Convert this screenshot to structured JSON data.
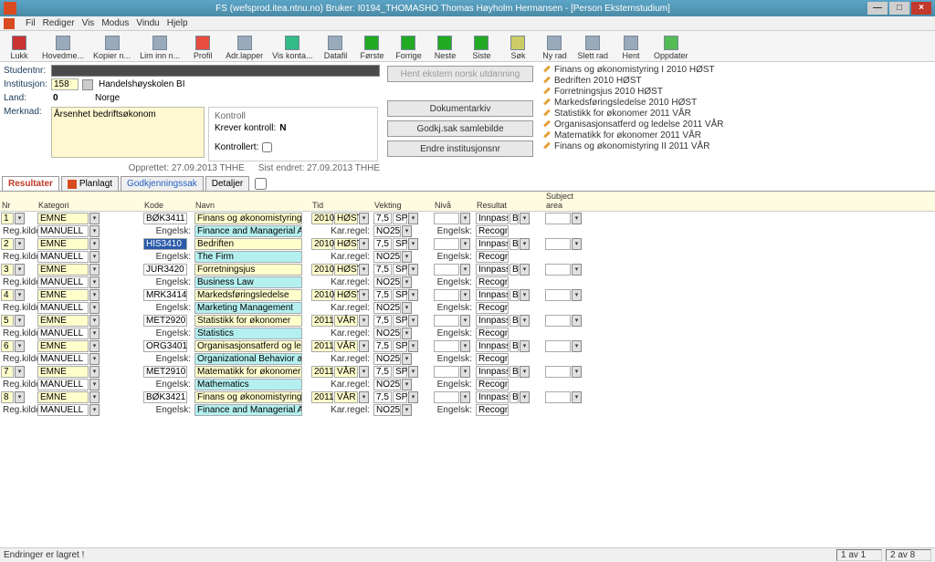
{
  "title": "FS (wefsprod.itea.ntnu.no) Bruker: I0194_THOMASHO Thomas Høyholm Hermansen - [Person Eksternstudium]",
  "menu": {
    "fil": "Fil",
    "rediger": "Rediger",
    "vis": "Vis",
    "modus": "Modus",
    "vindu": "Vindu",
    "hjelp": "Hjelp"
  },
  "toolbar": {
    "lukk": "Lukk",
    "hovedme": "Hovedme...",
    "kopier": "Kopier n...",
    "liminn": "Lim inn n...",
    "profil": "Profil",
    "adr": "Adr.lapper",
    "kontakt": "Vis konta...",
    "datafil": "Datafil",
    "forste": "Første",
    "forrige": "Forrige",
    "neste": "Neste",
    "siste": "Siste",
    "sok": "Søk",
    "nyrad": "Ny rad",
    "slett": "Slett rad",
    "hent": "Hent",
    "oppdater": "Oppdater"
  },
  "info": {
    "studentnr_lbl": "Studentnr:",
    "institusjon_lbl": "Institusjon:",
    "institusjon_val": "158",
    "institusjon_name": "Handelshøyskolen BI",
    "land_lbl": "Land:",
    "land_val": "0",
    "land_name": "Norge",
    "merknad_lbl": "Merknad:",
    "merknad_val": "Årsenhet bedriftsøkonom",
    "kontroll_hdr": "Kontroll",
    "krever": "Krever kontroll:",
    "krever_val": "N",
    "kontrollert": "Kontrollert:",
    "opprettet": "Opprettet: 27.09.2013    THHE",
    "endret": "Sist endret: 27.09.2013    THHE"
  },
  "buttons": {
    "hent_ekstern": "Hent ekstern norsk utdanning",
    "dokarkiv": "Dokumentarkiv",
    "godkj": "Godkj.sak samlebilde",
    "endre": "Endre institusjonsnr"
  },
  "side": [
    "Finans og økonomistyring I 2010 HØST",
    "Bedriften 2010 HØST",
    "Forretningsjus 2010 HØST",
    "Markedsføringsledelse 2010 HØST",
    "Statistikk for økonomer 2011 VÅR",
    "Organisasjonsatferd og ledelse 2011 VÅR",
    "Matematikk for økonomer 2011 VÅR",
    "Finans og økonomistyring II 2011 VÅR"
  ],
  "tabs": {
    "resultater": "Resultater",
    "planlagt": "Planlagt",
    "godkj": "Godkjenningssak",
    "detaljer": "Detaljer"
  },
  "headers": {
    "nr": "Nr",
    "kategori": "Kategori",
    "kode": "Kode",
    "navn": "Navn",
    "tid": "Tid",
    "vekting": "Vekting",
    "niva": "Nivå",
    "resultat": "Resultat",
    "subject": "Subject area"
  },
  "common": {
    "regkilde": "Reg.kilde:",
    "manuell": "MANUELL",
    "engelsk": "Engelsk:",
    "karregel": "Kar.regel:",
    "no25": "NO25",
    "engelsk2": "Engelsk:",
    "recogni": "Recogni",
    "emne": "EMNE",
    "sp": "SP",
    "innpass": "Innpasse",
    "b": "B",
    "host": "HØST",
    "var": "VÅR",
    "v75": "7,5"
  },
  "rows": [
    {
      "nr": "1",
      "kode": "BØK3411",
      "navn": "Finans og økonomistyring I",
      "en": "Finance and Managerial Ac...",
      "aar": "2010",
      "sem": "HØST"
    },
    {
      "nr": "2",
      "kode": "HIS3410",
      "navn": "Bedriften",
      "en": "The Firm",
      "aar": "2010",
      "sem": "HØST",
      "sel": true
    },
    {
      "nr": "3",
      "kode": "JUR3420",
      "navn": "Forretningsjus",
      "en": "Business Law",
      "aar": "2010",
      "sem": "HØST"
    },
    {
      "nr": "4",
      "kode": "MRK3414",
      "navn": "Markedsføringsledelse",
      "en": "Marketing Management",
      "aar": "2010",
      "sem": "HØST"
    },
    {
      "nr": "5",
      "kode": "MET2920",
      "navn": "Statistikk for økonomer",
      "en": "Statistics",
      "aar": "2011",
      "sem": "VÅR"
    },
    {
      "nr": "6",
      "kode": "ORG3401",
      "navn": "Organisasjonsatferd og lede...",
      "en": "Organizational Behavior an...",
      "aar": "2011",
      "sem": "VÅR"
    },
    {
      "nr": "7",
      "kode": "MET2910",
      "navn": "Matematikk for økonomer",
      "en": "Mathematics",
      "aar": "2011",
      "sem": "VÅR"
    },
    {
      "nr": "8",
      "kode": "BØK3421",
      "navn": "Finans og økonomistyring II",
      "en": "Finance and Managerial Ac...",
      "aar": "2011",
      "sem": "VÅR"
    }
  ],
  "status": {
    "msg": "Endringer er lagret !",
    "pg1": "1 av 1",
    "pg2": "2 av 8"
  }
}
